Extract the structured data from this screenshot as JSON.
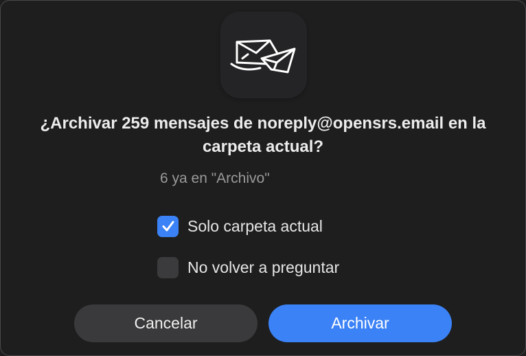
{
  "dialog": {
    "app_icon": "mail-archive-icon",
    "title": "¿Archivar 259 mensajes de noreply@opensrs.email en la carpeta actual?",
    "subtitle": "6 ya en \"Archivo\"",
    "options": [
      {
        "label": "Solo carpeta actual",
        "checked": true
      },
      {
        "label": "No volver a preguntar",
        "checked": false
      }
    ],
    "buttons": {
      "cancel_label": "Cancelar",
      "confirm_label": "Archivar"
    },
    "colors": {
      "accent": "#3b82f6",
      "background": "#1e1e1e"
    }
  }
}
